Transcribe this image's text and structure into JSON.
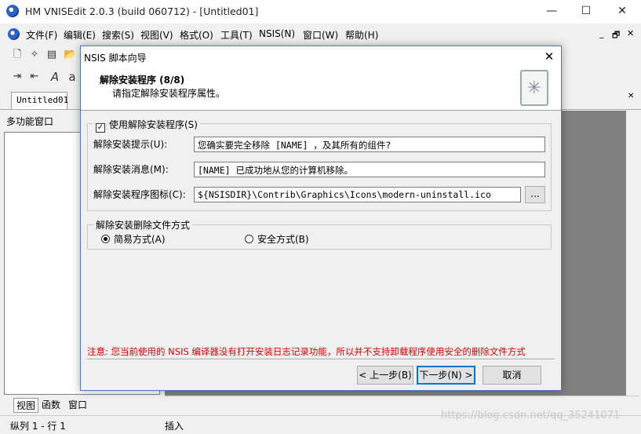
{
  "window": {
    "title": "HM VNISEdit 2.0.3 (build 060712) - [Untitled01]",
    "minimize": "—",
    "maximize": "☐",
    "close": "✕"
  },
  "menu": {
    "items": [
      "文件(F)",
      "编辑(E)",
      "搜索(S)",
      "视图(V)",
      "格式(O)",
      "工具(T)",
      "NSIS(N)",
      "窗口(W)",
      "帮助(H)"
    ],
    "mdi": [
      "_",
      "🗗",
      "✕"
    ]
  },
  "tabs": {
    "document": "Untitled01"
  },
  "panel": {
    "title": "多功能窗口",
    "tabs": [
      "视图",
      "函数",
      "窗口"
    ]
  },
  "status": {
    "position": "纵列 1 - 行 1",
    "mode": "插入"
  },
  "watermark": "https://blog.csdn.net/qq_35241071",
  "dialog": {
    "title": "NSIS 脚本向导",
    "close": "✕",
    "header_title": "解除安装程序 (8/8)",
    "header_subtitle": "请指定解除安装程序属性。",
    "group1": {
      "checkbox_label": "使用解除安装程序(S)",
      "checked": true,
      "prompt_label": "解除安装提示(U):",
      "prompt_value": "您确实要完全移除 [NAME] ，及其所有的组件?",
      "message_label": "解除安装消息(M):",
      "message_value": "[NAME] 已成功地从您的计算机移除。",
      "icon_label": "解除安装程序图标(C):",
      "icon_value": "${NSISDIR}\\Contrib\\Graphics\\Icons\\modern-uninstall.ico",
      "browse": "..."
    },
    "group2": {
      "legend": "解除安装删除文件方式",
      "option_simple": "简易方式(A)",
      "option_safe": "安全方式(B)",
      "selected": "simple"
    },
    "note": "注意: 您当前使用的 NSIS 编译器没有打开安装日志记录功能，所以并不支持卸载程序使用安全的删除文件方式",
    "buttons": {
      "back": "< 上一步(B)",
      "next": "下一步(N) >",
      "cancel": "取消"
    }
  }
}
